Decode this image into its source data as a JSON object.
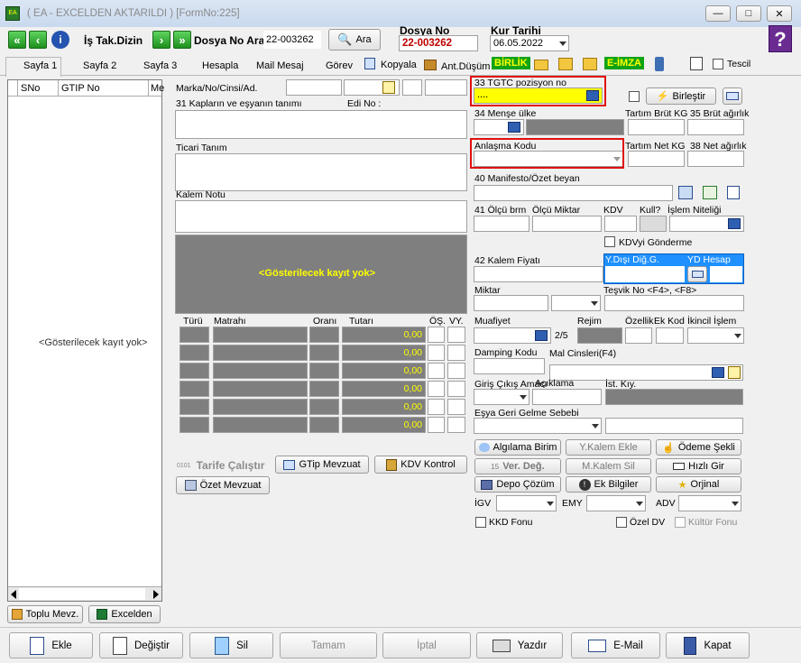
{
  "window": {
    "title": "( EA  - EXCELDEN AKTARILDI ) [FormNo:225]",
    "minimize": "—",
    "maximize": "□",
    "close": "✕"
  },
  "toolbar": {
    "is_takip": "İş Tak.Dizin",
    "dosya_ara_label": "Dosya No Ara",
    "dosya_ara_value": "22-003262",
    "ara_button": "Ara",
    "dosya_no_label": "Dosya No",
    "dosya_no_value": "22-003262",
    "kur_tarihi_label": "Kur Tarihi",
    "kur_tarihi_value": "06.05.2022",
    "help": "?"
  },
  "tabs": [
    "Sayfa 1",
    "Sayfa 2",
    "Sayfa 3",
    "Hesapla",
    "Mail Mesaj",
    "Görev",
    "Kopyala",
    "Ant.Düşüm",
    "BİRLİK",
    "E-İMZA",
    "Tescil"
  ],
  "left_grid": {
    "col_sno": "SNo",
    "col_gtip": "GTIP No",
    "col_me": "Me",
    "empty": "<Gösterilecek kayıt yok>",
    "toplu": "Toplu Mevz.",
    "excelden": "Excelden"
  },
  "center": {
    "marka_label": "Marka/No/Cinsi/Ad.",
    "kaplar_label": "31 Kapların ve eşyanın tanımı",
    "edi_label": "Edi No :",
    "ticari_label": "Ticari Tanım",
    "kalem_notu_label": "Kalem Notu",
    "empty_grid": "<Gösterilecek kayıt yok>"
  },
  "tax_table": {
    "headers": [
      "Türü",
      "Matrahı",
      "Oranı",
      "Tutarı",
      "ÖŞ.",
      "VY."
    ],
    "values": [
      "0,00",
      "0,00",
      "0,00",
      "0,00",
      "0,00",
      "0,00"
    ]
  },
  "center_buttons": {
    "tarife": "Tarife Çalıştır",
    "gtip": "GTip Mevzuat",
    "kdv": "KDV Kontrol",
    "ozet": "Özet Mevzuat"
  },
  "right": {
    "gtip_label": "33 TGTC pozisyon no",
    "gtip_value": "....",
    "birlestir": "Birleştir",
    "mense_label": "34 Menşe ülke",
    "tartim_brut_label": "Tartım Brüt KG",
    "brut_label": "35 Brüt ağırlık",
    "anlasma_label": "Anlaşma Kodu",
    "tartim_net_label": "Tartım Net KG",
    "net_label": "38 Net ağırlık",
    "manifesto_label": "40 Manifesto/Özet beyan",
    "olcu_brm_label": "41 Ölçü brm",
    "olcu_miktar_label": "Ölçü Miktar",
    "kdv_label": "KDV",
    "kull_label": "Kull?",
    "islem_niteligi_label": "İşlem Niteliği",
    "kdv_gonderme": "KDVyi Gönderme",
    "kalem_fiyati_label": "42 Kalem Fiyatı",
    "ydisi_label": "Y.Dışı Diğ.G.",
    "yd_hesap_label": "YD Hesap",
    "miktar_label": "Miktar",
    "tesvik_label": "Teşvik No <F4>, <F8>",
    "muafiyet_label": "Muafiyet",
    "rejim_label": "Rejim",
    "rejim_value": "2/5",
    "ozellik_label": "Özellik",
    "ek_kod_label": "Ek Kod",
    "ikincil_label": "İkincil İşlem",
    "damping_label": "Damping Kodu",
    "mal_cinsleri_label": "Mal Cinsleri(F4)",
    "giris_cikis_label": "Giriş Çıkış Amacı",
    "aciklama_label": "Açıklama",
    "ist_kiy_label": "İst. Kıy.",
    "esya_geri_label": "Eşya Geri Gelme Sebebi",
    "btn_alg": "Algılama Birim",
    "btn_ykalem": "Y.Kalem Ekle",
    "btn_odeme": "Ödeme Şekli",
    "btn_verdeg": "Ver. Değ.",
    "btn_mkalem": "M.Kalem Sil",
    "btn_hizli": "Hızlı Gir",
    "btn_depo": "Depo Çözüm",
    "btn_ek": "Ek Bilgiler",
    "btn_orijinal": "Orjinal",
    "igv_label": "İGV",
    "emy_label": "EMY",
    "adv_label": "ADV",
    "kkd_label": "KKD Fonu",
    "ozel_dv_label": "Özel DV",
    "kultur_label": "Kültür Fonu"
  },
  "bottom": {
    "ekle": "Ekle",
    "degistir": "Değiştir",
    "sil": "Sil",
    "tamam": "Tamam",
    "iptal": "İptal",
    "yazdir": "Yazdır",
    "email": "E-Mail",
    "kapat": "Kapat"
  }
}
